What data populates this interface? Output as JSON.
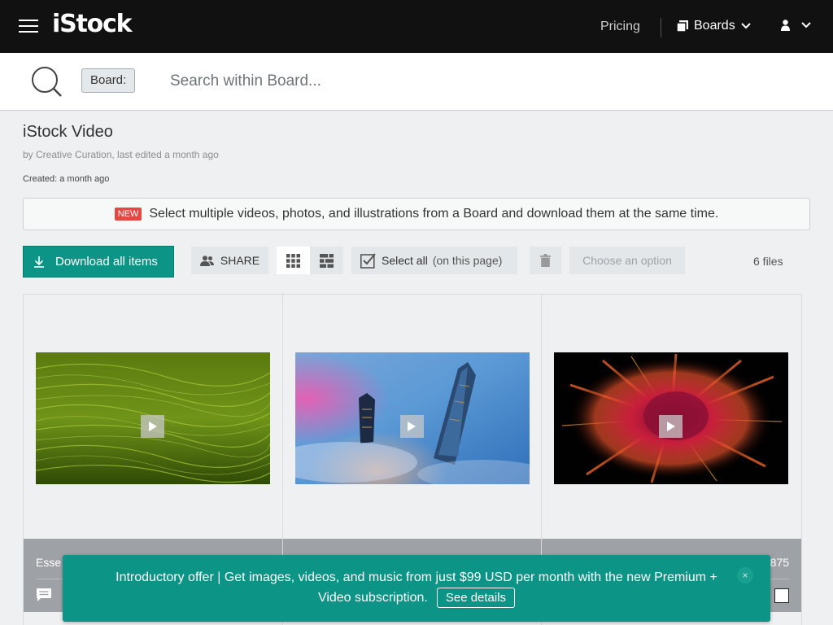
{
  "header": {
    "logo": "iStock",
    "pricing": "Pricing",
    "boards": "Boards"
  },
  "search": {
    "chip": "Board:",
    "placeholder": "Search within Board..."
  },
  "board": {
    "title": "iStock Video",
    "meta": "by Creative Curation, last edited a month ago",
    "created": "Created: a month ago"
  },
  "notice": {
    "badge": "NEW",
    "text": "Select multiple videos, photos, and illustrations from a Board and download them at the same time."
  },
  "toolbar": {
    "download": "Download all items",
    "share": "SHARE",
    "select_all": "Select all",
    "select_all_note": "(on this page)",
    "choose_option": "Choose an option",
    "files_count": "6 files"
  },
  "cards": [
    {
      "title": "Esse",
      "number": "",
      "thumb": "green-grass"
    },
    {
      "title": "",
      "number": "",
      "thumb": "city-towers-fog"
    },
    {
      "title": "",
      "number": "875",
      "thumb": "red-powder-explosion"
    }
  ],
  "promo": {
    "text_line1": "Introductory offer | Get images, videos, and music from just $99 USD per month with the new Premium +",
    "text_line2": "Video subscription.",
    "cta": "See details",
    "close": "×"
  },
  "colors": {
    "accent": "#0c9486",
    "topbar": "#111111",
    "badge": "#e34844"
  }
}
